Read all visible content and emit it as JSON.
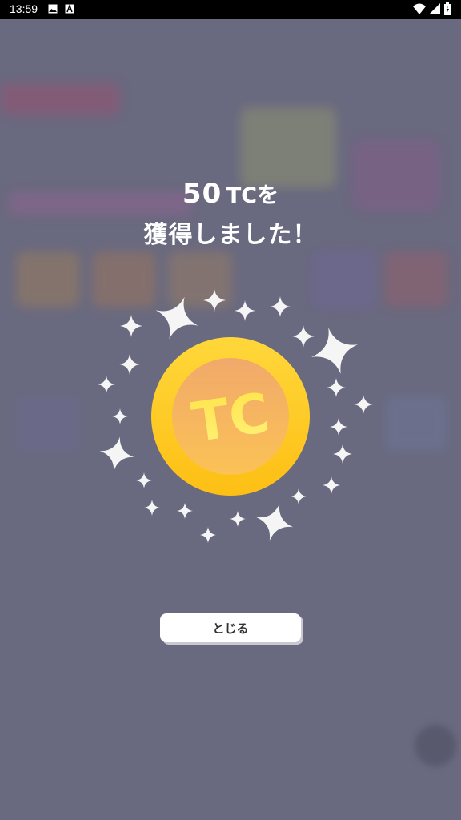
{
  "status_bar": {
    "time": "13:59",
    "icons": [
      "image-icon",
      "a-badge-icon",
      "wifi-icon",
      "signal-icon",
      "battery-icon"
    ]
  },
  "dialog": {
    "amount": "50",
    "unit": "TC",
    "line1_suffix": "を",
    "line2": "獲得しました！",
    "coin_label": "TC",
    "close_label": "とじる"
  },
  "colors": {
    "overlay": "#73738a",
    "coin_outer": "#FFD21E",
    "coin_inner": "#F3A35E",
    "button_bg": "#ffffff"
  }
}
